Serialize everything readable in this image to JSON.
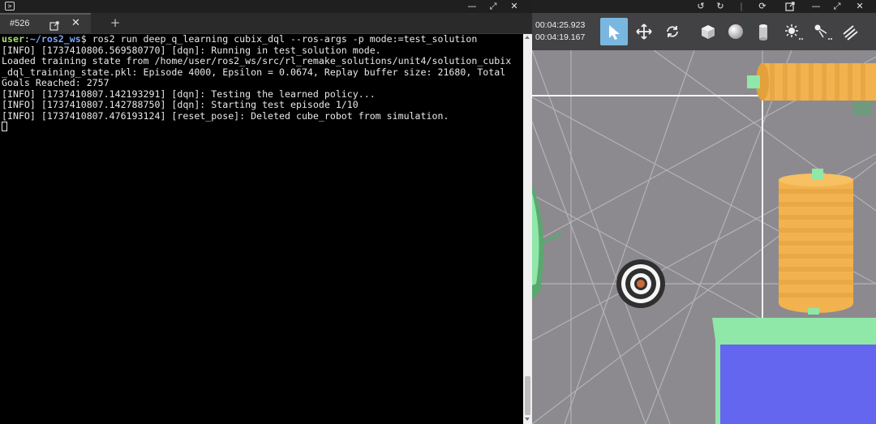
{
  "terminal": {
    "tab": {
      "label": "#526"
    },
    "prompt": {
      "user": "user",
      "sep": ":",
      "path": "~/ros2_ws",
      "dollar": "$"
    },
    "command": " ros2 run deep_q_learning cubix_dql --ros-args -p mode:=test_solution",
    "lines": [
      "[INFO] [1737410806.569580770] [dqn]: Running in test_solution mode.",
      "Loaded training state from /home/user/ros2_ws/src/rl_remake_solutions/unit4/solution_cubix",
      "_dql_training_state.pkl: Episode 4000, Epsilon = 0.0674, Replay buffer size: 21680, Total",
      "Goals Reached: 2757",
      "[INFO] [1737410807.142193291] [dqn]: Testing the learned policy...",
      "[INFO] [1737410807.142788750] [dqn]: Starting test episode 1/10",
      "[INFO] [1737410807.476193124] [reset_pose]: Deleted cube_robot from simulation."
    ]
  },
  "simulator": {
    "sim_time": "00:04:25.923",
    "real_time": "00:04:19.167",
    "toolbar": [
      {
        "name": "select-mode-button",
        "icon": "arrow-pointer-icon",
        "active": true
      },
      {
        "name": "translate-mode-button",
        "icon": "move-arrows-icon",
        "active": false
      },
      {
        "name": "rotate-mode-button",
        "icon": "rotate-icon",
        "active": false
      },
      {
        "name": "box-shape-button",
        "icon": "cube-icon",
        "active": false
      },
      {
        "name": "sphere-shape-button",
        "icon": "sphere-icon",
        "active": false
      },
      {
        "name": "cylinder-shape-button",
        "icon": "cylinder-icon",
        "active": false
      },
      {
        "name": "point-light-button",
        "icon": "sun-icon",
        "active": false
      },
      {
        "name": "spot-light-button",
        "icon": "spot-light-icon",
        "active": false
      },
      {
        "name": "directional-light-button",
        "icon": "directional-light-icon",
        "active": false
      }
    ]
  },
  "colors": {
    "terminal_bg": "#000000",
    "prompt_user": "#9ee06f",
    "prompt_path": "#7aa6ff",
    "scene_ground": "#8c8a8e",
    "obstacle_orange": "#f2b34e",
    "goal_green": "#8fe7a8",
    "block_blue": "#6466f0",
    "toolbar_active": "#7ab7e0"
  }
}
